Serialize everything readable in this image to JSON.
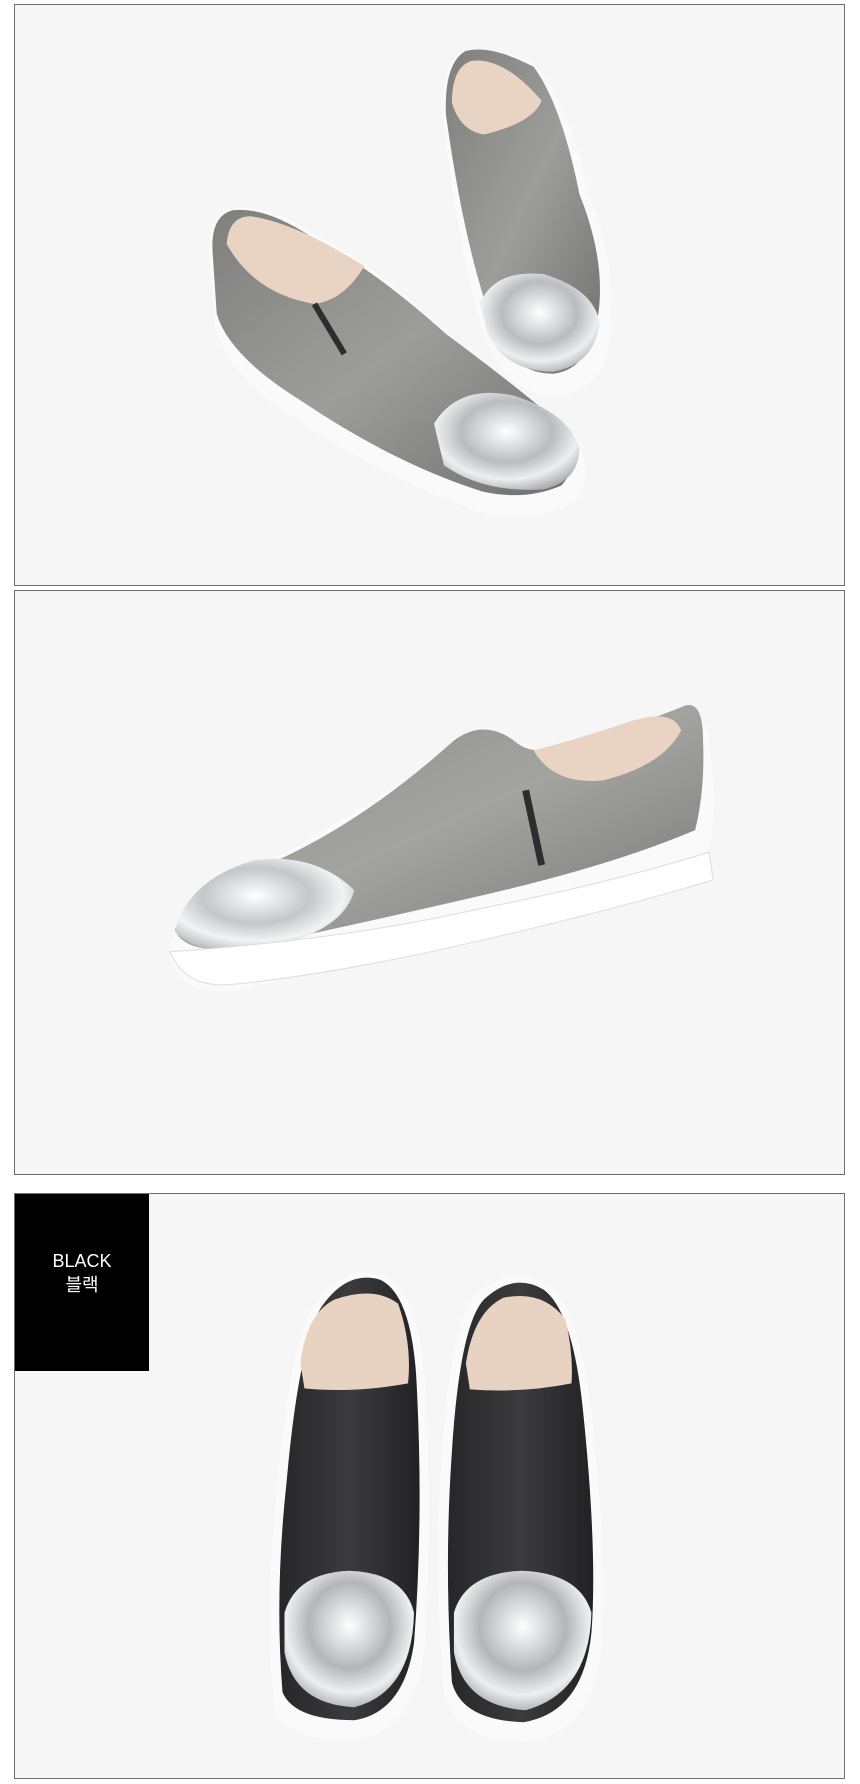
{
  "panels": [
    {
      "id": "panel-1",
      "image": "gray-slip-on-pair-angled-photo"
    },
    {
      "id": "panel-2",
      "image": "gray-slip-on-side-view-photo"
    },
    {
      "id": "panel-3",
      "image": "black-slip-on-pair-top-view-photo",
      "badge": {
        "name_en": "BLACK",
        "name_ko": "블랙"
      }
    }
  ],
  "colors": {
    "background": "#f6f6f6",
    "border": "#6e6e6e",
    "badge_bg": "#000000",
    "badge_text": "#ffffff",
    "shoe_gray": "#8a8a88",
    "shoe_black": "#2f2f31",
    "toe_silver": "#d4d6d8",
    "sole": "#fafafa",
    "lining": "#e8d3c3"
  }
}
